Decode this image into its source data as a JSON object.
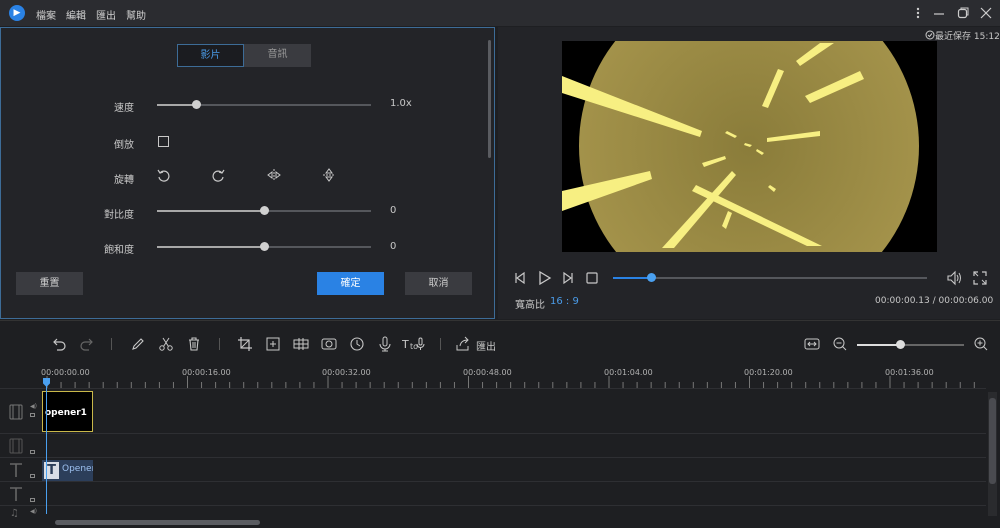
{
  "menu": {
    "items": [
      "檔案",
      "編輯",
      "匯出",
      "幫助"
    ]
  },
  "colors": {
    "accent": "#2a82e4",
    "text_track": "#9ec1f0"
  },
  "left_panel": {
    "tabs": [
      {
        "label": "影片",
        "active": true
      },
      {
        "label": "音訊",
        "active": false
      }
    ],
    "speed": {
      "label": "速度",
      "value": "1.0x",
      "level": 0.18
    },
    "reverse": {
      "label": "倒放",
      "checked": false
    },
    "rotate": {
      "label": "旋轉",
      "icons": [
        "rotate-left-icon",
        "rotate-right-icon",
        "flip-horizontal-icon",
        "flip-vertical-icon"
      ]
    },
    "contrast": {
      "label": "對比度",
      "value": "0",
      "level": 0.5
    },
    "saturation": {
      "label": "飽和度",
      "value": "0",
      "level": 0.5
    },
    "reset_label": "重置",
    "confirm_label": "確定",
    "cancel_label": "取消"
  },
  "preview": {
    "last_saved": "最近保存 15:12",
    "aspect_label": "寬高比",
    "aspect_value": "16 : 9",
    "time": "00:00:00.13 / 00:00:06.00",
    "progress": 0.12
  },
  "toolbar": {
    "export_label": "匯出",
    "zoom_level": 0.4
  },
  "timeline": {
    "ticks": [
      "00:00:00.00",
      "00:00:16.00",
      "00:00:32.00",
      "00:00:48.00",
      "00:01:04.00",
      "00:01:20.00",
      "00:01:36.00"
    ],
    "video_clip_label": "opener1",
    "text_clip_label": "Opener"
  }
}
